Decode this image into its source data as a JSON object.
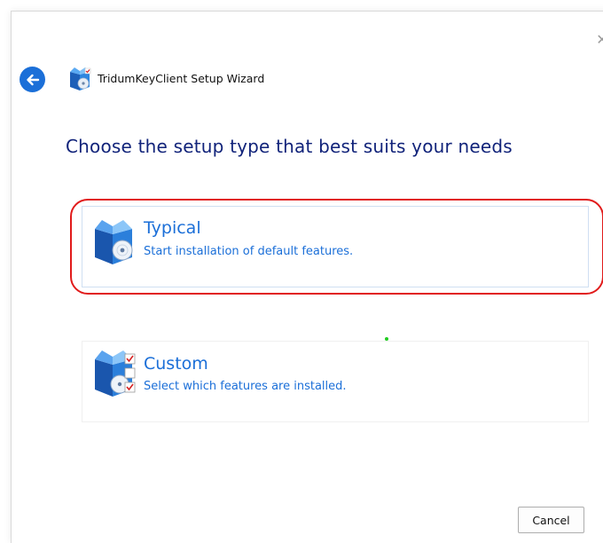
{
  "window": {
    "title": "TridumKeyClient Setup Wizard",
    "close_symbol": "✕"
  },
  "heading": "Choose the setup type that best suits your needs",
  "options": [
    {
      "title": "Typical",
      "description": "Start installation of default features.",
      "icon": "installer-box-disc-icon",
      "highlighted": true
    },
    {
      "title": "Custom",
      "description": "Select which features are installed.",
      "icon": "installer-box-checklist-icon",
      "highlighted": false
    }
  ],
  "footer": {
    "cancel_label": "Cancel"
  },
  "colors": {
    "accent": "#1b6fd8",
    "heading": "#11237a",
    "highlight_ring": "#e11b1b",
    "indicator_dot": "#22cc22"
  }
}
